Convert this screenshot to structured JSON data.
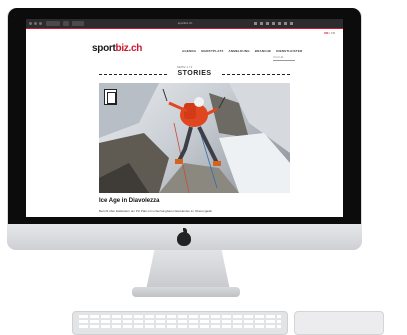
{
  "browser": {
    "url": "sportbiz.ch"
  },
  "site": {
    "language": {
      "active": "DE",
      "other": "FR"
    },
    "logo": {
      "part1": "sport",
      "part2": "biz.ch"
    },
    "nav": [
      "AGENDA",
      "MARKTPLATZ",
      "ANMELDUNG",
      "BRANCHE",
      "DIENSTLEISTER"
    ],
    "search_placeholder": "SUCHE"
  },
  "section": {
    "kicker": "SEITE 1 / 3",
    "title": "STORIES"
  },
  "article": {
    "title": "Ice Age in Diavolezza",
    "subtitle": "Bericht über Eisklettern am Piz Palü mit unbezwingbaren Eiswänden im Oberengadin"
  },
  "colors": {
    "brand_red": "#d0142c",
    "climber_jacket": "#e0461f"
  },
  "icons": [
    "apple-logo-icon",
    "climber-badge-icon"
  ]
}
